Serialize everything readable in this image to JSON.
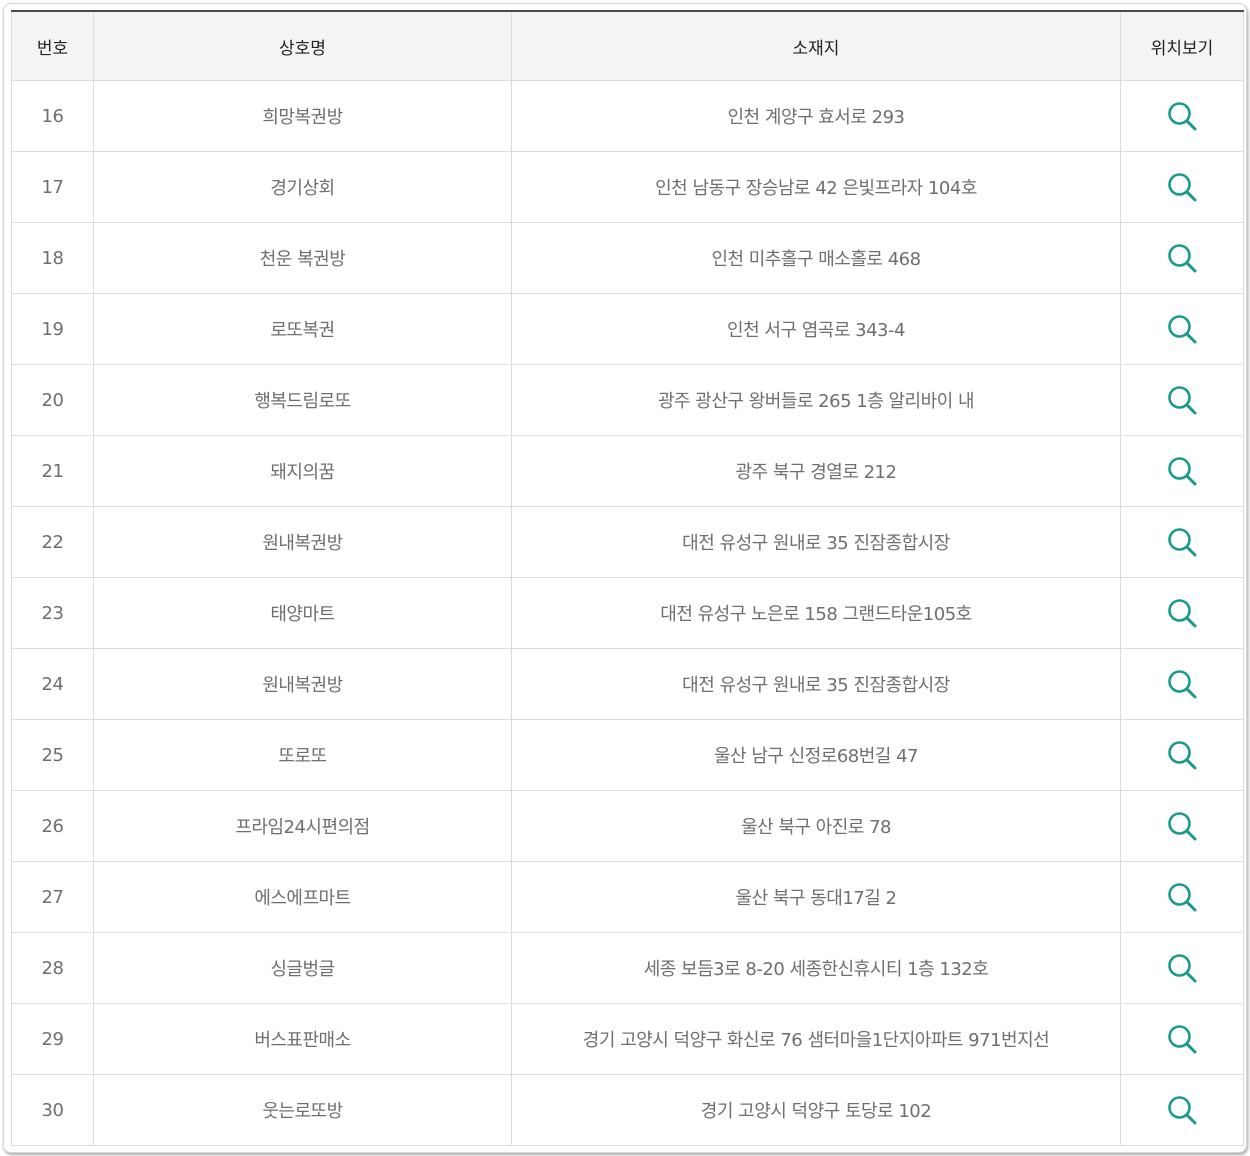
{
  "table": {
    "headers": {
      "no": "번호",
      "name": "상호명",
      "address": "소재지",
      "map": "위치보기"
    },
    "accent_color": "#1a9a8a",
    "map_icon": "search-icon",
    "rows": [
      {
        "no": "16",
        "name": "희망복권방",
        "address": "인천 계양구 효서로 293"
      },
      {
        "no": "17",
        "name": "경기상회",
        "address": "인천 남동구 장승남로 42 은빛프라자 104호"
      },
      {
        "no": "18",
        "name": "천운 복권방",
        "address": "인천 미추홀구 매소홀로 468"
      },
      {
        "no": "19",
        "name": "로또복권",
        "address": "인천 서구 염곡로 343-4"
      },
      {
        "no": "20",
        "name": "행복드림로또",
        "address": "광주 광산구 왕버들로 265 1층 알리바이 내"
      },
      {
        "no": "21",
        "name": "돼지의꿈",
        "address": "광주 북구 경열로 212"
      },
      {
        "no": "22",
        "name": "원내복권방",
        "address": "대전 유성구 원내로 35 진잠종합시장"
      },
      {
        "no": "23",
        "name": "태양마트",
        "address": "대전 유성구 노은로 158 그랜드타운105호"
      },
      {
        "no": "24",
        "name": "원내복권방",
        "address": "대전 유성구 원내로 35 진잠종합시장"
      },
      {
        "no": "25",
        "name": "또로또",
        "address": "울산 남구 신정로68번길 47"
      },
      {
        "no": "26",
        "name": "프라임24시편의점",
        "address": "울산 북구 아진로 78"
      },
      {
        "no": "27",
        "name": "에스에프마트",
        "address": "울산 북구 동대17길 2"
      },
      {
        "no": "28",
        "name": "싱글벙글",
        "address": "세종 보듬3로 8-20 세종한신휴시티 1층 132호"
      },
      {
        "no": "29",
        "name": "버스표판매소",
        "address": "경기 고양시 덕양구 화신로 76 샘터마을1단지아파트 971번지선"
      },
      {
        "no": "30",
        "name": "웃는로또방",
        "address": "경기 고양시 덕양구 토당로 102"
      }
    ]
  }
}
